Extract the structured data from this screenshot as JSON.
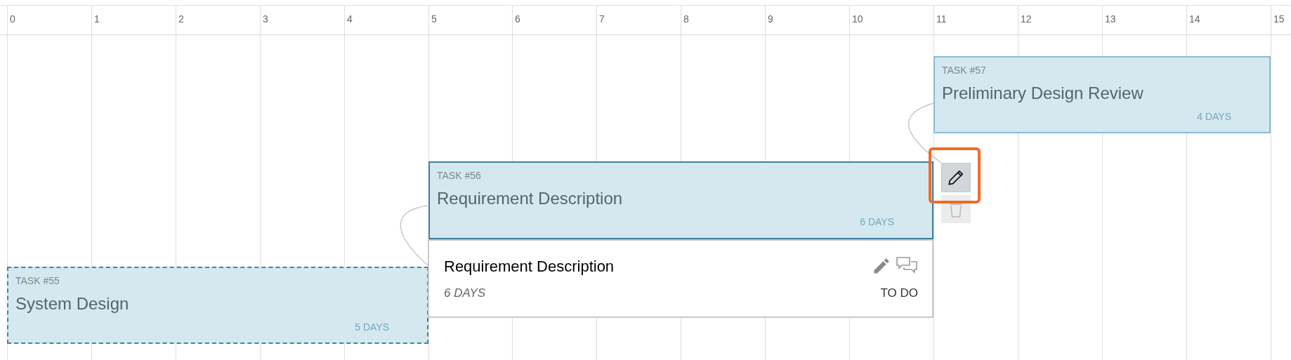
{
  "timeline": {
    "ticks": [
      "0",
      "1",
      "2",
      "3",
      "4",
      "5",
      "6",
      "7",
      "8",
      "9",
      "10",
      "11",
      "12",
      "13",
      "14",
      "15"
    ]
  },
  "tasks": [
    {
      "label": "TASK #57",
      "title": "Preliminary Design Review",
      "duration": "4 DAYS",
      "selected": false,
      "dashed": false
    },
    {
      "label": "TASK #56",
      "title": "Requirement Description",
      "duration": "6 DAYS",
      "selected": true,
      "dashed": false
    },
    {
      "label": "TASK #55",
      "title": "System Design",
      "duration": "5 DAYS",
      "selected": false,
      "dashed": true
    }
  ],
  "popup": {
    "title": "Requirement Description",
    "duration": "6 DAYS",
    "status": "TO DO"
  }
}
